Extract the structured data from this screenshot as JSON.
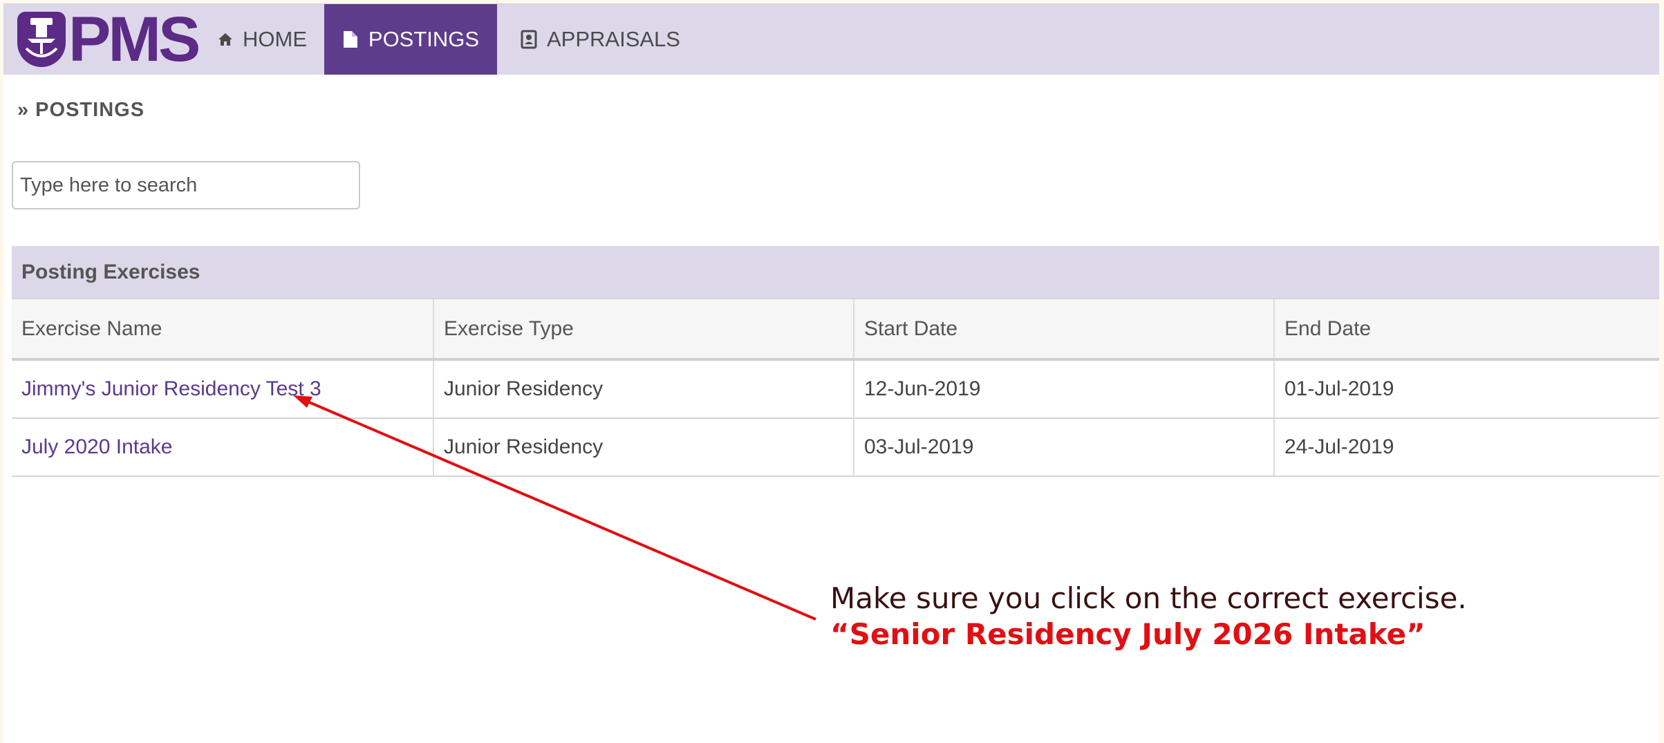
{
  "app": {
    "logo_text": "PMS",
    "accent": "#5d3c8c",
    "nav_bg": "#dcd8ea"
  },
  "nav": {
    "items": [
      {
        "label": "HOME",
        "icon": "home-icon",
        "active": false
      },
      {
        "label": "POSTINGS",
        "icon": "document-icon",
        "active": true
      },
      {
        "label": "APPRAISALS",
        "icon": "id-card-icon",
        "active": false
      }
    ]
  },
  "breadcrumb": {
    "label": "» POSTINGS"
  },
  "search": {
    "placeholder": "Type here to search",
    "value": ""
  },
  "table": {
    "title": "Posting Exercises",
    "columns": [
      "Exercise Name",
      "Exercise Type",
      "Start Date",
      "End Date"
    ],
    "rows": [
      {
        "name": "Jimmy's Junior Residency Test 3",
        "type": "Junior Residency",
        "start": "12-Jun-2019",
        "end": "01-Jul-2019"
      },
      {
        "name": "July 2020 Intake",
        "type": "Junior Residency",
        "start": "03-Jul-2019",
        "end": "24-Jul-2019"
      }
    ]
  },
  "annotation": {
    "line1": "Make sure you click on the correct exercise.",
    "line2": "“Senior Residency July 2026 Intake”",
    "color": "#e10f13"
  }
}
